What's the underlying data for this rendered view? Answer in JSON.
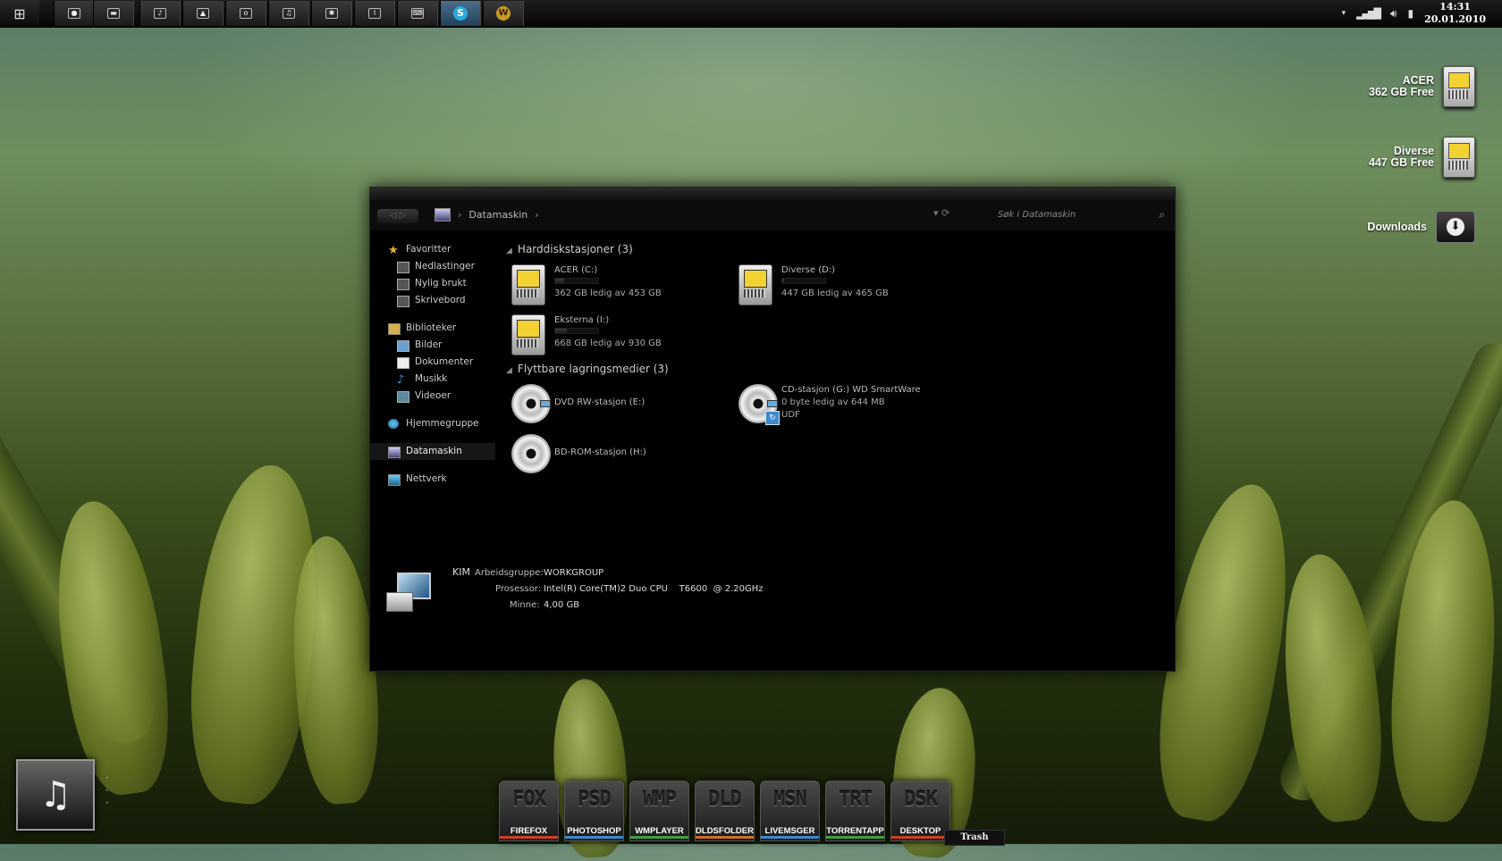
{
  "taskbar": {
    "buttons": [
      "explorer",
      "folder",
      "music",
      "pictures",
      "camera",
      "music-note",
      "settings",
      "terminal",
      "keyboard",
      "skype",
      "warcraft"
    ],
    "clock": {
      "time": "14:31",
      "date": "20.01.2010"
    }
  },
  "desktop": {
    "drives": [
      {
        "name": "ACER",
        "free": "362 GB Free"
      },
      {
        "name": "Diverse",
        "free": "447 GB Free"
      }
    ],
    "downloads_label": "Downloads"
  },
  "explorer": {
    "breadcrumb": "Datamaskin",
    "search_placeholder": "Søk i Datamaskin",
    "nav": {
      "favorites": "Favoritter",
      "favorites_items": [
        "Nedlastinger",
        "Nylig brukt",
        "Skrivebord"
      ],
      "libraries": "Biblioteker",
      "libraries_items": [
        "Bilder",
        "Dokumenter",
        "Musikk",
        "Videoer"
      ],
      "homegroup": "Hjemmegruppe",
      "computer": "Datamaskin",
      "network": "Nettverk"
    },
    "hard_drives_header": "Harddiskstasjoner (3)",
    "hard_drives": [
      {
        "name": "ACER (C:)",
        "free": "362 GB ledig av 453 GB",
        "used_fraction": 0.2
      },
      {
        "name": "Diverse (D:)",
        "free": "447 GB ledig av 465 GB",
        "used_fraction": 0.04
      },
      {
        "name": "Eksterna (I:)",
        "free": "668 GB ledig av 930 GB",
        "used_fraction": 0.28
      }
    ],
    "removable_header": "Flyttbare lagringsmedier (3)",
    "removable": [
      {
        "name": "DVD RW-stasjon (E:)"
      },
      {
        "name": "CD-stasjon (G:) WD SmartWare",
        "free": "0 byte ledig av 644 MB",
        "fs": "UDF"
      },
      {
        "name": "BD-ROM-stasjon (H:)"
      }
    ],
    "details": {
      "computer_name": "KIM",
      "workgroup_label": "Arbeidsgruppe:",
      "workgroup": "WORKGROUP",
      "processor_label": "Prosessor:",
      "processor": "Intel(R) Core(TM)2 Duo CPU    T6600  @ 2.20GHz",
      "memory_label": "Minne:",
      "memory": "4,00 GB"
    }
  },
  "dock": [
    {
      "code": "FOX",
      "label": "FIREFOX",
      "color": "#d04020"
    },
    {
      "code": "PSD",
      "label": "PHOTOSHOP",
      "color": "#3a8ad0"
    },
    {
      "code": "WMP",
      "label": "WMPLAYER",
      "color": "#40a040"
    },
    {
      "code": "DLD",
      "label": "DLDSFOLDER",
      "color": "#d07020"
    },
    {
      "code": "MSN",
      "label": "LIVEMSGER",
      "color": "#3a8ad0"
    },
    {
      "code": "TRT",
      "label": "TORRENTAPP",
      "color": "#40a040"
    },
    {
      "code": "DSK",
      "label": "DESKTOP",
      "color": "#d04020"
    }
  ],
  "trash_label": "Trash"
}
